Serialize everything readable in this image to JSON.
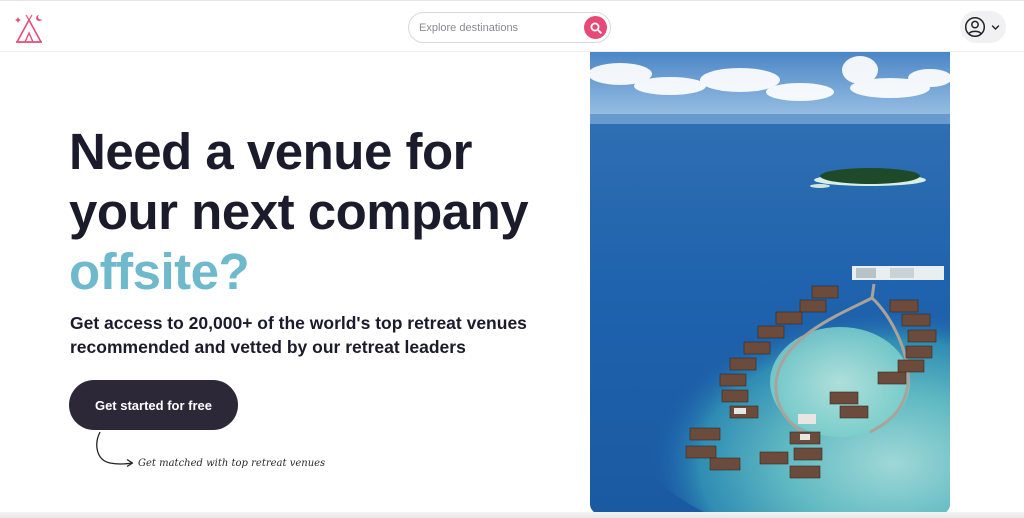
{
  "header": {
    "logo_icon": "tent-sparkle-logo-icon",
    "search": {
      "placeholder": "Explore destinations",
      "icon": "search-icon"
    },
    "account": {
      "avatar_icon": "user-circle-icon",
      "chevron_icon": "chevron-down-icon"
    }
  },
  "hero": {
    "title_line1": "Need a venue for",
    "title_line2": "your next company",
    "title_accent": "offsite?",
    "subtitle_line1": "Get access to 20,000+ of the world's top retreat venues",
    "subtitle_line2": "recommended and vetted by our retreat leaders",
    "cta_label": "Get started for free",
    "cta_hint": "Get matched with top retreat venues",
    "image_subject": "aerial view of overwater villas on a tropical island lagoon"
  },
  "colors": {
    "brand_pink": "#e84a78",
    "accent_teal": "#6fb9cc",
    "dark_text": "#1c1b2b",
    "cta_bg": "#2c2838"
  }
}
